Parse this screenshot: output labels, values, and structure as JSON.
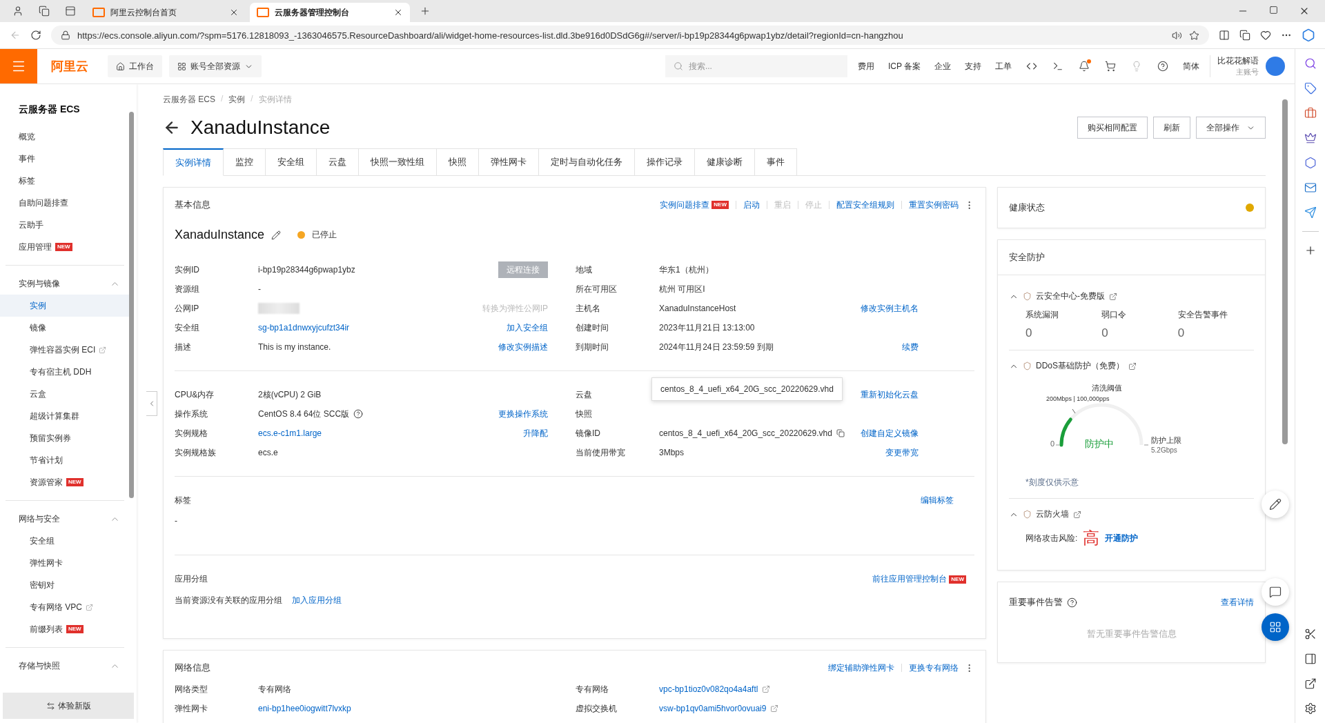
{
  "browser": {
    "tabs": [
      {
        "title": "阿里云控制台首页",
        "selected": false
      },
      {
        "title": "云服务器管理控制台",
        "selected": true
      }
    ],
    "url": "https://ecs.console.aliyun.com/?spm=5176.12818093_-1363046575.ResourceDashboard/ali/widget-home-resources-list.dld.3be916d0DSdG6g#/server/i-bp19p28344g6pwap1ybz/detail?regionId=cn-hangzhou"
  },
  "header": {
    "logo": "阿里云",
    "workbench": "工作台",
    "resources": "账号全部资源",
    "search_placeholder": "搜索...",
    "links": [
      "费用",
      "ICP 备案",
      "企业",
      "支持",
      "工单"
    ],
    "notification_dot": true,
    "language": "简体",
    "account": {
      "name": "比花花解语",
      "role": "主账号"
    }
  },
  "sidebar": {
    "title": "云服务器 ECS",
    "items": [
      {
        "label": "概览",
        "selected": false
      },
      {
        "label": "事件",
        "selected": false
      },
      {
        "label": "标签",
        "selected": false
      },
      {
        "label": "自助问题排查",
        "selected": false
      },
      {
        "label": "云助手",
        "selected": false
      },
      {
        "label": "应用管理",
        "selected": false,
        "badge": "NEW"
      }
    ],
    "groups": [
      {
        "title": "实例与镜像",
        "expanded": true,
        "items": [
          {
            "label": "实例",
            "selected": true
          },
          {
            "label": "镜像",
            "selected": false
          },
          {
            "label": "弹性容器实例 ECI",
            "selected": false,
            "external": true
          },
          {
            "label": "专有宿主机 DDH",
            "selected": false
          },
          {
            "label": "云盒",
            "selected": false
          },
          {
            "label": "超级计算集群",
            "selected": false
          },
          {
            "label": "预留实例券",
            "selected": false
          },
          {
            "label": "节省计划",
            "selected": false
          },
          {
            "label": "资源管家",
            "selected": false,
            "badge": "NEW"
          }
        ]
      },
      {
        "title": "网络与安全",
        "expanded": true,
        "items": [
          {
            "label": "安全组",
            "selected": false
          },
          {
            "label": "弹性网卡",
            "selected": false
          },
          {
            "label": "密钥对",
            "selected": false
          },
          {
            "label": "专有网络 VPC",
            "selected": false,
            "external": true
          },
          {
            "label": "前缀列表",
            "selected": false,
            "badge": "NEW"
          }
        ]
      },
      {
        "title": "存储与快照",
        "expanded": true
      }
    ],
    "footer": "体验新版"
  },
  "breadcrumb_separator": "/",
  "breadcrumb": [
    {
      "label": "云服务器 ECS",
      "current": false
    },
    {
      "label": "实例",
      "current": false
    },
    {
      "label": "实例详情",
      "current": true
    }
  ],
  "title": "XanaduInstance",
  "actions": [
    {
      "label": "购买相同配置",
      "kind": "button"
    },
    {
      "label": "刷新",
      "kind": "button"
    },
    {
      "label": "全部操作",
      "kind": "dropdown"
    }
  ],
  "tabs": [
    {
      "label": "实例详情",
      "selected": true
    },
    {
      "label": "监控",
      "selected": false
    },
    {
      "label": "安全组",
      "selected": false
    },
    {
      "label": "云盘",
      "selected": false
    },
    {
      "label": "快照一致性组",
      "selected": false
    },
    {
      "label": "快照",
      "selected": false
    },
    {
      "label": "弹性网卡",
      "selected": false
    },
    {
      "label": "定时与自动化任务",
      "selected": false
    },
    {
      "label": "操作记录",
      "selected": false
    },
    {
      "label": "健康诊断",
      "selected": false
    },
    {
      "label": "事件",
      "selected": false
    }
  ],
  "basic": {
    "heading": "基本信息",
    "actions": [
      {
        "label": "实例问题排查",
        "badge": "NEW",
        "disabled": false
      },
      {
        "label": "启动",
        "disabled": false
      },
      {
        "label": "重启",
        "disabled": true
      },
      {
        "label": "停止",
        "disabled": true
      },
      {
        "label": "配置安全组规则",
        "disabled": false
      },
      {
        "label": "重置实例密码",
        "disabled": false
      }
    ],
    "name": "XanaduInstance",
    "status": "已停止",
    "groups": [
      {
        "left": [
          {
            "label": "实例ID",
            "value": "i-bp19p28344g6pwap1ybz",
            "action": {
              "label": "远程连接",
              "kind": "button",
              "disabled": true
            }
          },
          {
            "label": "资源组",
            "value": "-"
          },
          {
            "label": "公网IP",
            "masked": true,
            "action": {
              "label": "转换为弹性公网IP",
              "kind": "link",
              "disabled": true
            }
          },
          {
            "label": "安全组",
            "value": "sg-bp1a1dnwxyjcufzt34ir",
            "link": true,
            "action": {
              "label": "加入安全组",
              "kind": "link",
              "disabled": false
            }
          },
          {
            "label": "描述",
            "value": "This is my instance.",
            "action": {
              "label": "修改实例描述",
              "kind": "link",
              "disabled": false
            }
          }
        ],
        "right": [
          {
            "label": "地域",
            "value": "华东1（杭州）"
          },
          {
            "label": "所在可用区",
            "value": "杭州 可用区I"
          },
          {
            "label": "主机名",
            "value": "XanaduInstanceHost",
            "action": {
              "label": "修改实例主机名",
              "kind": "link",
              "disabled": false
            }
          },
          {
            "label": "创建时间",
            "value": "2023年11月21日 13:13:00"
          },
          {
            "label": "到期时间",
            "value": "2024年11月24日 23:59:59 到期",
            "action": {
              "label": "续费",
              "kind": "link",
              "disabled": false
            }
          }
        ]
      },
      {
        "left": [
          {
            "label": "CPU&内存",
            "value": "2核(vCPU) 2 GiB"
          },
          {
            "label": "操作系统",
            "value": "CentOS 8.4 64位 SCC版",
            "help": true,
            "action": {
              "label": "更换操作系统",
              "kind": "link",
              "disabled": false
            }
          },
          {
            "label": "实例规格",
            "value": "ecs.e-c1m1.large",
            "link": true,
            "action": {
              "label": "升降配",
              "kind": "link",
              "disabled": false
            }
          },
          {
            "label": "实例规格族",
            "value": "ecs.e"
          }
        ],
        "right": [
          {
            "label": "云盘",
            "action": {
              "label": "重新初始化云盘",
              "kind": "link",
              "disabled": false
            }
          },
          {
            "label": "快照"
          },
          {
            "label": "镜像ID",
            "value": "centos_8_4_uefi_x64_20G_scc_20220629.vhd",
            "copyable": true,
            "action": {
              "label": "创建自定义镜像",
              "kind": "link",
              "disabled": false
            }
          },
          {
            "label": "当前使用带宽",
            "value": "3Mbps",
            "action": {
              "label": "变更带宽",
              "kind": "link",
              "disabled": false
            }
          }
        ],
        "tooltip": "centos_8_4_uefi_x64_20G_scc_20220629.vhd"
      }
    ],
    "tags": {
      "heading": "标签",
      "value": "-",
      "action": "编辑标签"
    },
    "app_group": {
      "heading": "应用分组",
      "action": "前往应用管理控制台",
      "badge": "NEW",
      "text": "当前资源没有关联的应用分组",
      "link": "加入应用分组"
    }
  },
  "network": {
    "heading": "网络信息",
    "actions": [
      "绑定辅助弹性网卡",
      "更换专有网络"
    ],
    "left": [
      {
        "label": "网络类型",
        "value": "专有网络"
      },
      {
        "label": "弹性网卡",
        "value": "eni-bp1hee0iogwitt7lvxkp",
        "link": true
      }
    ],
    "right": [
      {
        "label": "专有网络",
        "value": "vpc-bp1tioz0v082qo4a4aftl",
        "link": true,
        "external": true
      },
      {
        "label": "虚拟交换机",
        "value": "vsw-bp1qv0ami5hvor0ovuai9",
        "link": true,
        "external": true
      }
    ]
  },
  "health": {
    "title": "健康状态",
    "warning": true
  },
  "security": {
    "title": "安全防护",
    "sections": [
      {
        "kind": "stats",
        "title": "云安全中心-免费版",
        "expanded": true,
        "stats": [
          {
            "label": "系统漏洞",
            "value": "0"
          },
          {
            "label": "弱口令",
            "value": "0"
          },
          {
            "label": "安全告警事件",
            "value": "0"
          }
        ]
      },
      {
        "kind": "gauge",
        "title": "DDoS基础防护（免费）",
        "expanded": true,
        "threshold_label": "清洗阈值",
        "threshold_value": "200Mbps | 100,000pps",
        "zero": "0",
        "status": "防护中",
        "level": 0.22,
        "max_label": "防护上限",
        "max_value": "5.2Gbps",
        "note": "*刻度仅供示意"
      },
      {
        "kind": "risk",
        "title": "云防火墙",
        "expanded": true,
        "risk_label": "网络攻击风险:",
        "risk_level": "高",
        "action": "开通防护"
      }
    ]
  },
  "alerts": {
    "title": "重要事件告警",
    "link": "查看详情",
    "empty": "暂无重要事件告警信息"
  }
}
